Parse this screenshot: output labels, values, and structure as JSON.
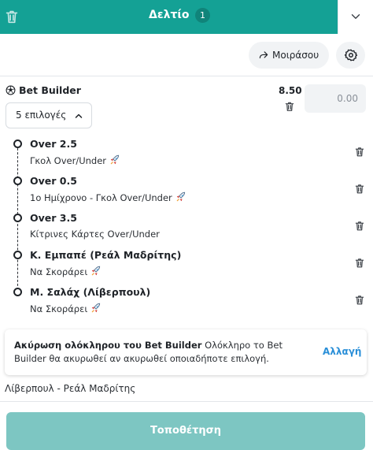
{
  "header": {
    "title": "Δελτίο",
    "count": "1",
    "icons": {
      "delete": "trash-icon",
      "collapse": "chevron-down-icon"
    },
    "accent_color": "#14a195"
  },
  "toolbar": {
    "share_label": "Μοιράσου",
    "share_icon": "share-arrow-icon",
    "settings_icon": "gear-icon"
  },
  "bet_builder": {
    "icon": "soccer-ball-icon",
    "title": "Bet Builder",
    "odds": "8.50",
    "stake_placeholder": "0.00",
    "selections_label": "5 επιλογές",
    "selections": [
      {
        "title": "Over 2.5",
        "market": "Γκολ Over/Under",
        "boosted": true
      },
      {
        "title": "Over 0.5",
        "market": "1ο Ημίχρονο - Γκολ Over/Under",
        "boosted": true
      },
      {
        "title": "Over 3.5",
        "market": "Κίτρινες Κάρτες Over/Under",
        "boosted": false
      },
      {
        "title": "Κ. Εμπαπέ (Ρεάλ Μαδρίτης)",
        "market": "Να Σκοράρει",
        "boosted": true
      },
      {
        "title": "Μ. Σαλάχ (Λίβερπουλ)",
        "market": "Να Σκοράρει",
        "boosted": true
      }
    ]
  },
  "info": {
    "bold_text": "Ακύρωση ολόκληρου του Bet Builder",
    "text": "Ολόκληρο το Bet Builder θα ακυρωθεί αν ακυρωθεί οποιαδήποτε επιλογή.",
    "link": "Αλλαγή",
    "link_color": "#2a8fd8"
  },
  "match": "Λίβερπουλ - Ρεάλ Μαδρίτης",
  "place_button": "Τοποθέτηση",
  "place_button_color": "#7dc6c2"
}
